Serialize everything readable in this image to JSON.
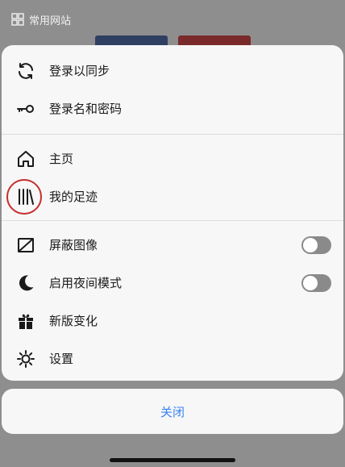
{
  "background": {
    "header_label": "常用网站"
  },
  "menu": {
    "sections": [
      [
        {
          "label": "登录以同步",
          "icon": "sync-icon"
        },
        {
          "label": "登录名和密码",
          "icon": "key-icon"
        }
      ],
      [
        {
          "label": "主页",
          "icon": "home-icon"
        },
        {
          "label": "我的足迹",
          "icon": "library-icon"
        }
      ],
      [
        {
          "label": "屏蔽图像",
          "icon": "image-off-icon",
          "toggle": false
        },
        {
          "label": "启用夜间模式",
          "icon": "moon-icon",
          "toggle": false
        },
        {
          "label": "新版变化",
          "icon": "gift-icon"
        },
        {
          "label": "设置",
          "icon": "gear-icon"
        }
      ]
    ]
  },
  "close_label": "关闭",
  "colors": {
    "accent": "#3a82f7",
    "highlight_ring": "#c62e2e",
    "toggle_off": "#8a8a8a"
  }
}
